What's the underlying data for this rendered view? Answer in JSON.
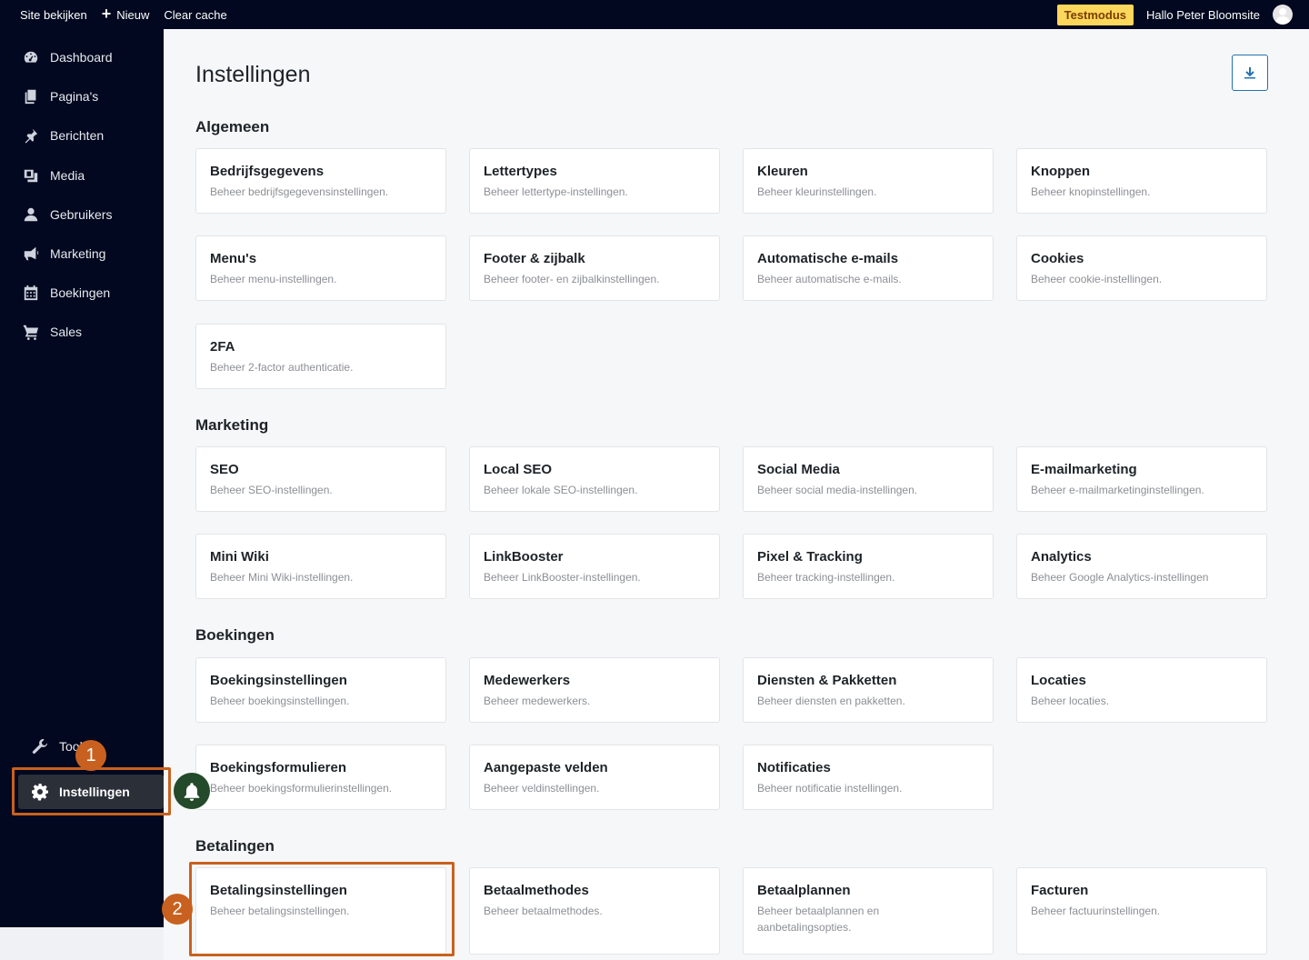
{
  "topbar": {
    "site_view": "Site bekijken",
    "new_label": "Nieuw",
    "clear_cache": "Clear cache",
    "test_mode": "Testmodus",
    "greeting": "Hallo Peter Bloomsite"
  },
  "sidebar": {
    "items": [
      {
        "label": "Dashboard",
        "icon": "dashboard-icon"
      },
      {
        "label": "Pagina's",
        "icon": "pages-icon"
      },
      {
        "label": "Berichten",
        "icon": "pin-icon"
      },
      {
        "label": "Media",
        "icon": "media-icon"
      },
      {
        "label": "Gebruikers",
        "icon": "user-icon"
      },
      {
        "label": "Marketing",
        "icon": "megaphone-icon"
      },
      {
        "label": "Boekingen",
        "icon": "calendar-icon"
      },
      {
        "label": "Sales",
        "icon": "cart-icon"
      }
    ],
    "tools_label": "Tools",
    "settings_label": "Instellingen"
  },
  "callouts": {
    "one": "1",
    "two": "2"
  },
  "page": {
    "title": "Instellingen"
  },
  "sections": [
    {
      "title": "Algemeen",
      "cards": [
        {
          "title": "Bedrijfsgegevens",
          "desc": "Beheer bedrijfsgegevensinstellingen."
        },
        {
          "title": "Lettertypes",
          "desc": "Beheer lettertype-instellingen."
        },
        {
          "title": "Kleuren",
          "desc": "Beheer kleurinstellingen."
        },
        {
          "title": "Knoppen",
          "desc": "Beheer knopinstellingen."
        },
        {
          "title": "Menu's",
          "desc": "Beheer menu-instellingen."
        },
        {
          "title": "Footer & zijbalk",
          "desc": "Beheer footer- en zijbalkinstellingen."
        },
        {
          "title": "Automatische e-mails",
          "desc": "Beheer automatische e-mails."
        },
        {
          "title": "Cookies",
          "desc": "Beheer cookie-instellingen."
        },
        {
          "title": "2FA",
          "desc": "Beheer 2-factor authenticatie."
        }
      ]
    },
    {
      "title": "Marketing",
      "cards": [
        {
          "title": "SEO",
          "desc": "Beheer SEO-instellingen."
        },
        {
          "title": "Local SEO",
          "desc": "Beheer lokale SEO-instellingen."
        },
        {
          "title": "Social Media",
          "desc": "Beheer social media-instellingen."
        },
        {
          "title": "E-mailmarketing",
          "desc": "Beheer e-mailmarketinginstellingen."
        },
        {
          "title": "Mini Wiki",
          "desc": "Beheer Mini Wiki-instellingen."
        },
        {
          "title": "LinkBooster",
          "desc": "Beheer LinkBooster-instellingen."
        },
        {
          "title": "Pixel & Tracking",
          "desc": "Beheer tracking-instellingen."
        },
        {
          "title": "Analytics",
          "desc": "Beheer Google Analytics-instellingen"
        }
      ]
    },
    {
      "title": "Boekingen",
      "cards": [
        {
          "title": "Boekingsinstellingen",
          "desc": "Beheer boekingsinstellingen."
        },
        {
          "title": "Medewerkers",
          "desc": "Beheer medewerkers."
        },
        {
          "title": "Diensten & Pakketten",
          "desc": "Beheer diensten en pakketten."
        },
        {
          "title": "Locaties",
          "desc": "Beheer locaties."
        },
        {
          "title": "Boekingsformulieren",
          "desc": "Beheer boekingsformulierinstellingen."
        },
        {
          "title": "Aangepaste velden",
          "desc": "Beheer veldinstellingen."
        },
        {
          "title": "Notificaties",
          "desc": "Beheer notificatie instellingen."
        }
      ]
    },
    {
      "title": "Betalingen",
      "cards": [
        {
          "title": "Betalingsinstellingen",
          "desc": "Beheer betalingsinstellingen."
        },
        {
          "title": "Betaalmethodes",
          "desc": "Beheer betaalmethodes."
        },
        {
          "title": "Betaalplannen",
          "desc": "Beheer betaalplannen en aanbetalingsopties."
        },
        {
          "title": "Facturen",
          "desc": "Beheer factuurinstellingen."
        }
      ]
    }
  ]
}
